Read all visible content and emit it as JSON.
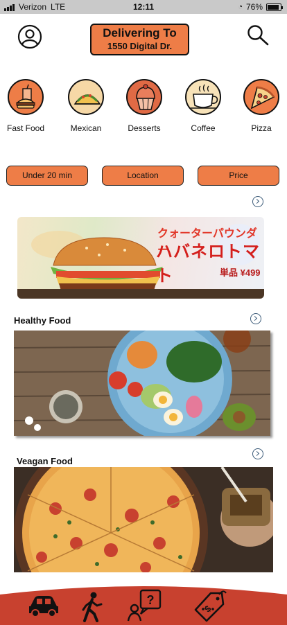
{
  "status_bar": {
    "carrier": "Verizon",
    "network": "LTE",
    "time": "12:11",
    "battery": "76%"
  },
  "header": {
    "deliver_title": "Delivering To",
    "address": "1550 Digital Dr."
  },
  "categories": [
    {
      "label": "Fast Food",
      "icon": "burger-drink-icon"
    },
    {
      "label": "Mexican",
      "icon": "taco-icon"
    },
    {
      "label": "Desserts",
      "icon": "cupcake-icon"
    },
    {
      "label": "Coffee",
      "icon": "coffee-cup-icon"
    },
    {
      "label": "Pizza",
      "icon": "pizza-slice-icon"
    }
  ],
  "filters": [
    "Under 20 min",
    "Location",
    "Price"
  ],
  "promo": {
    "line1": "クォーターパウンダー",
    "line2": "ハバネロトマト",
    "price": "単品 ¥499"
  },
  "sections": [
    {
      "title": "Healthy Food"
    },
    {
      "title": "Veagan Food"
    }
  ],
  "bottom_nav": [
    "car-icon",
    "walking-person-icon",
    "help-chat-icon",
    "price-tag-icon"
  ],
  "colors": {
    "accent": "#ee7d47",
    "bottom_bar": "#c8412f"
  }
}
